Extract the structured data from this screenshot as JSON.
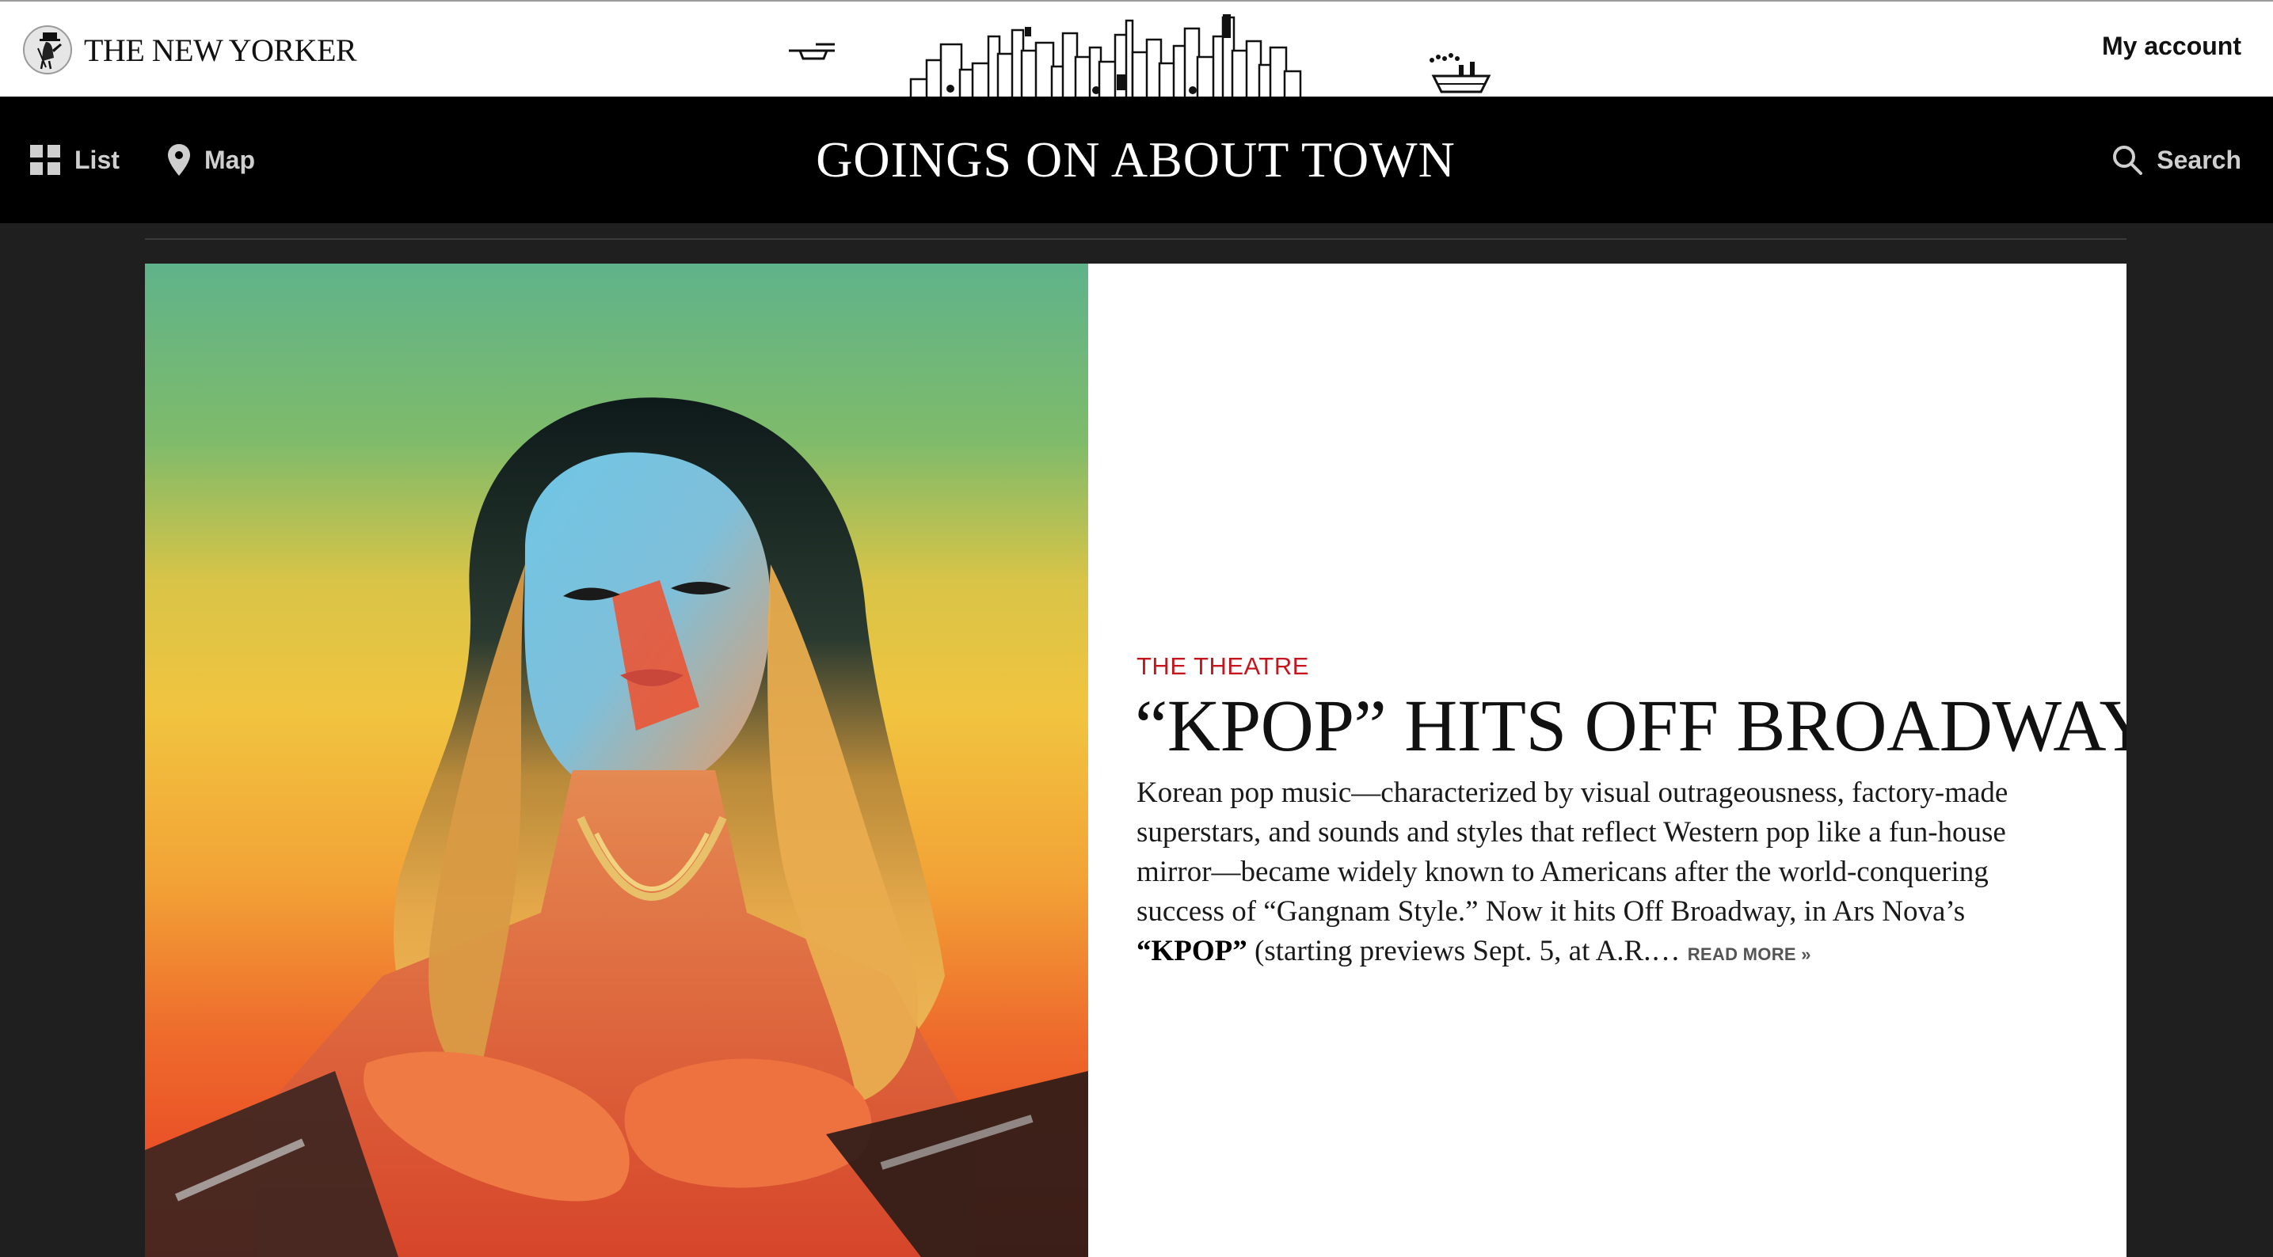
{
  "header": {
    "brand": "THE NEW YORKER",
    "account_label": "My account"
  },
  "nav": {
    "list_label": "List",
    "map_label": "Map",
    "title": "GOINGS ON ABOUT TOWN",
    "search_label": "Search"
  },
  "feature": {
    "section": "THE THEATRE",
    "headline": "“KPOP” HITS OFF BROADWAY",
    "body_before_bold": "Korean pop music—characterized by visual outrageousness, factory-made superstars, and sounds and styles that reflect Western pop like a fun-house mirror—became widely known to Americans after the world-conquering success of “Gangnam Style.” Now it hits Off Broadway, in Ars Nova’s ",
    "body_bold": "“KPOP”",
    "body_after_bold": " (starting previews Sept. 5, at A.R.…",
    "read_more": "READ MORE »"
  },
  "colors": {
    "section_red": "#c4161c",
    "navbar_bg": "#000000",
    "page_bg": "#1f1f1f"
  },
  "icons": {
    "list": "grid-icon",
    "map": "map-pin-icon",
    "search": "search-icon"
  }
}
